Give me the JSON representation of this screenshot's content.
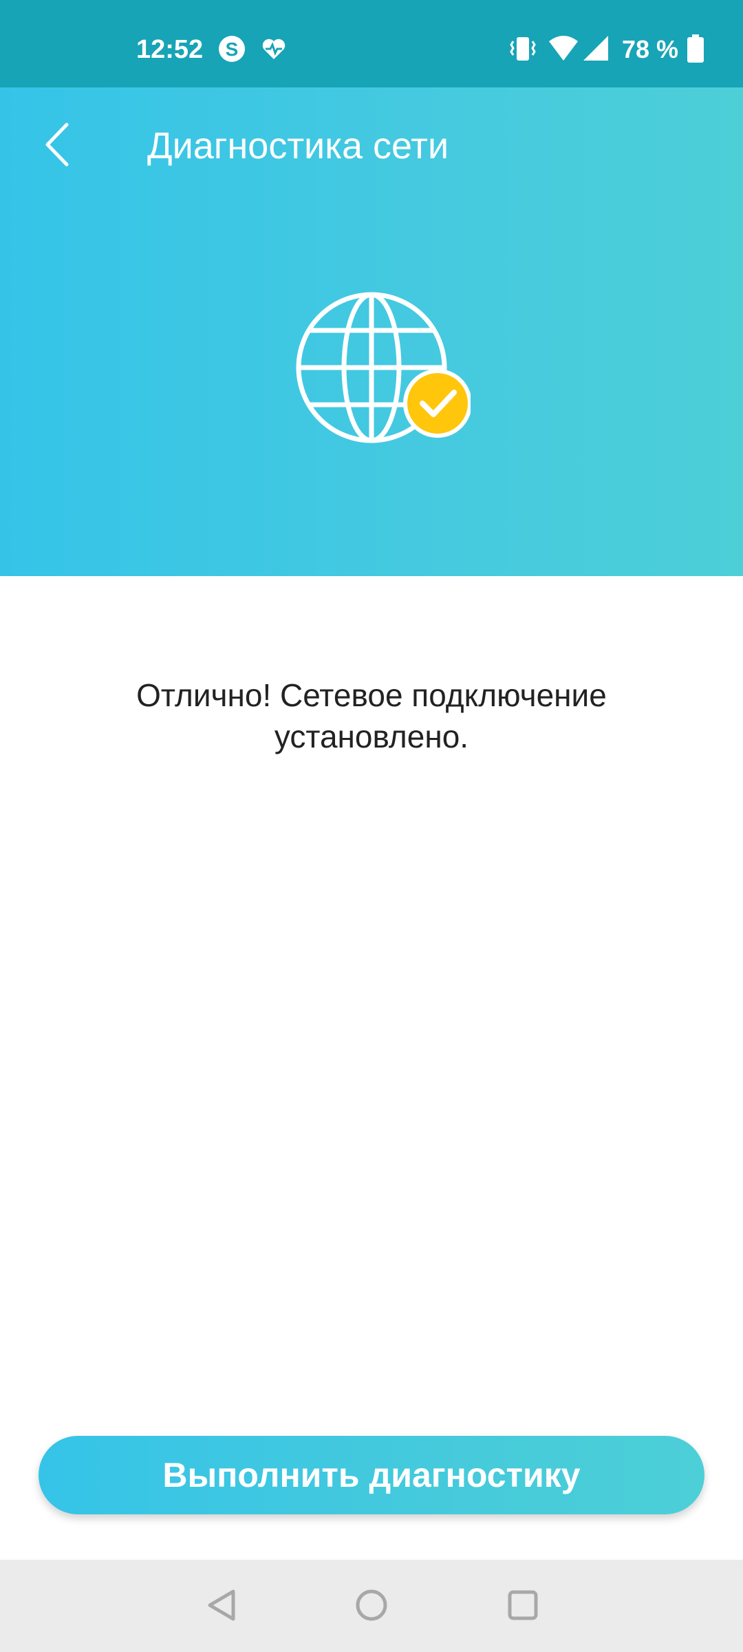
{
  "status_bar": {
    "time": "12:52",
    "battery": "78 %",
    "icons": [
      "skype-icon",
      "heart-pulse-icon",
      "vibrate-icon",
      "wifi-icon",
      "signal-icon",
      "battery-icon"
    ]
  },
  "header": {
    "title": "Диагностика сети",
    "back_icon": "chevron-left-icon",
    "hero_icon": "globe-check-icon",
    "gradient_colors": [
      "#35c4e8",
      "#4dcfd8"
    ]
  },
  "main": {
    "message": "Отлично! Сетевое подключение установлено."
  },
  "actions": {
    "run_diagnostics_label": "Выполнить диагностику"
  },
  "nav_bar": {
    "items": [
      "back-triangle-icon",
      "home-circle-icon",
      "recents-square-icon"
    ]
  },
  "colors": {
    "status_bar": "#17a4b6",
    "accent_yellow": "#ffc60b",
    "text": "#222222"
  }
}
